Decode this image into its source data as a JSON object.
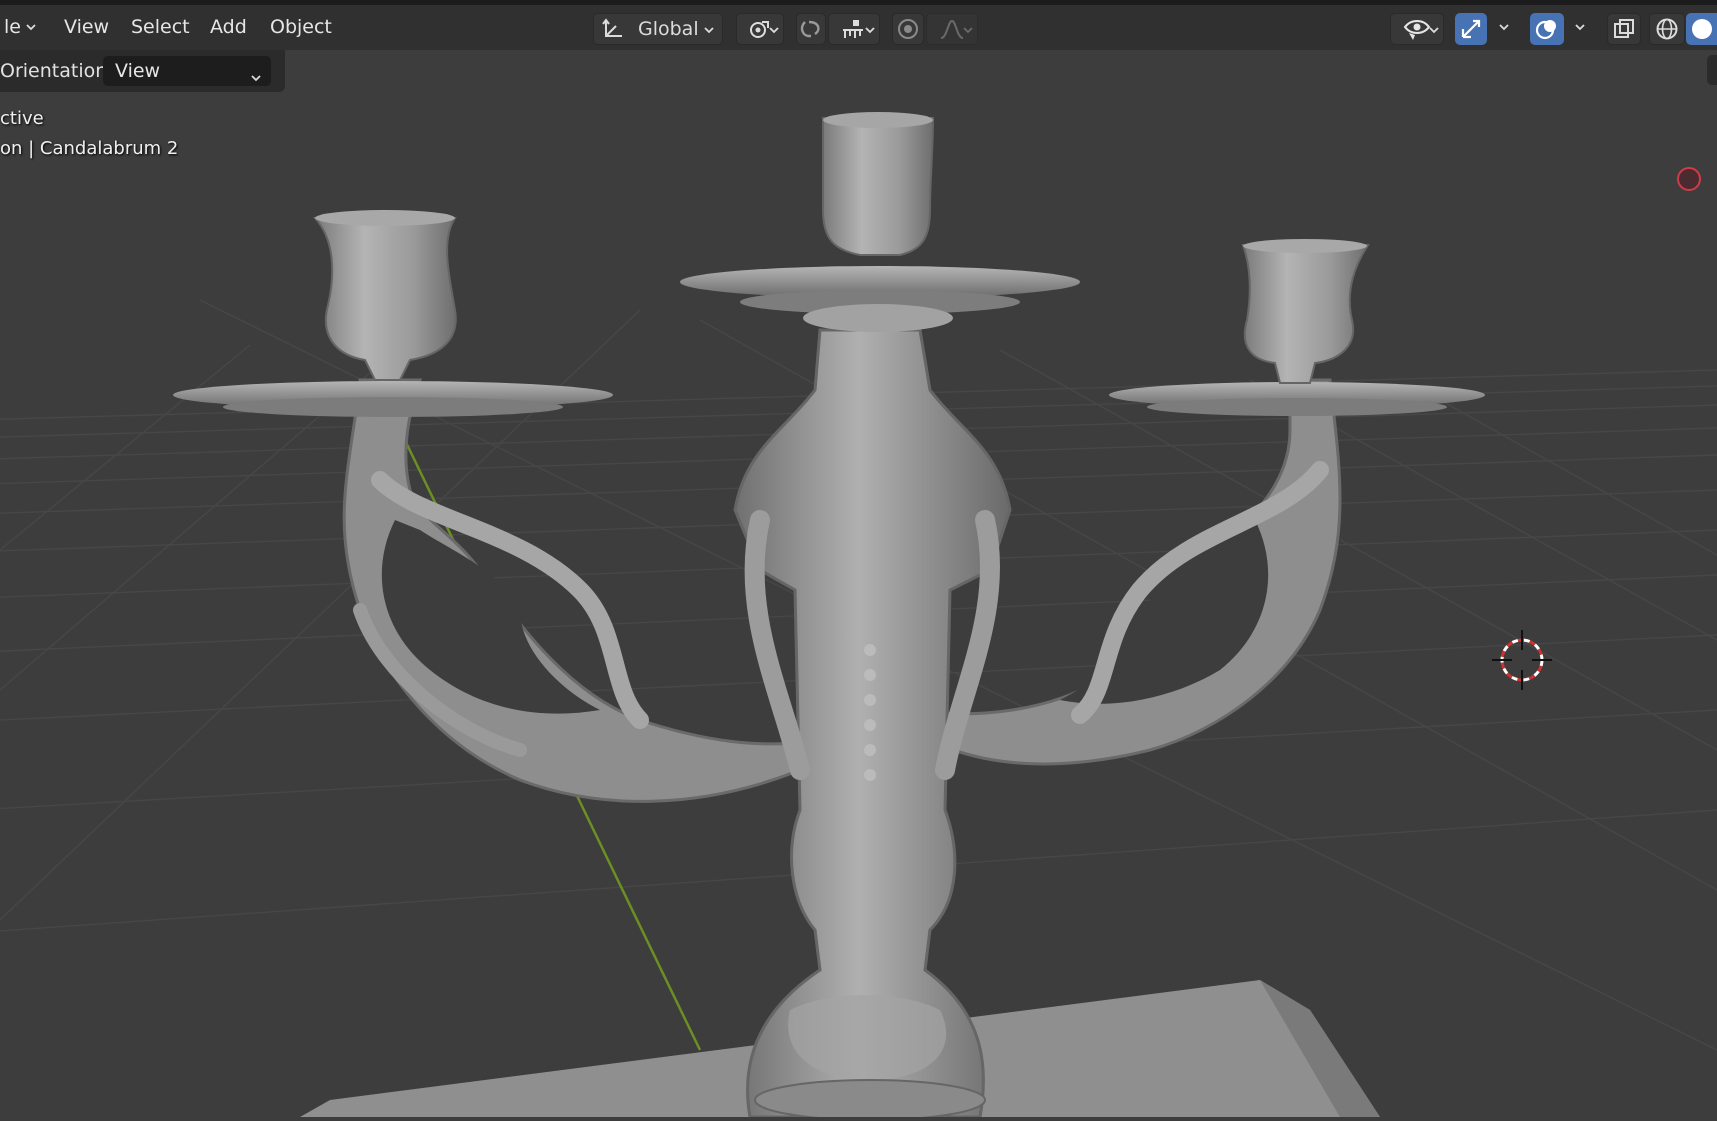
{
  "header": {
    "menu": [
      {
        "label": "le",
        "has_chevron": true
      },
      {
        "label": "View"
      },
      {
        "label": "Select"
      },
      {
        "label": "Add"
      },
      {
        "label": "Object"
      }
    ],
    "transform_orientation": "Global",
    "icons": {
      "orientation": "transform-orientation-icon",
      "pivot": "pivot-point-icon",
      "snap": "snap-magnet-icon",
      "snap_target": "snap-increment-icon",
      "proportional": "proportional-editing-icon",
      "falloff": "falloff-curve-icon",
      "visibility": "eye-icon",
      "gizmo": "gizmo-icon",
      "overlay": "overlay-icon",
      "xray": "xray-toggle-icon",
      "wireframe": "wireframe-shading-icon",
      "solid": "solid-shading-icon"
    }
  },
  "toolbar": {
    "orientation_label": "Orientation:",
    "orientation_value": "View"
  },
  "viewport": {
    "overlay_line1": "ctive",
    "overlay_line2": "on | Candalabrum 2",
    "object_name": "Candalabrum 2"
  },
  "colors": {
    "header_bg": "#303030",
    "viewport_bg": "#3d3d3d",
    "grid_line": "#4a4a4a",
    "y_axis": "#6b8f23",
    "active_blue": "#4772b3",
    "record_red": "#d23a4a",
    "mesh": "#a8a8a8"
  }
}
